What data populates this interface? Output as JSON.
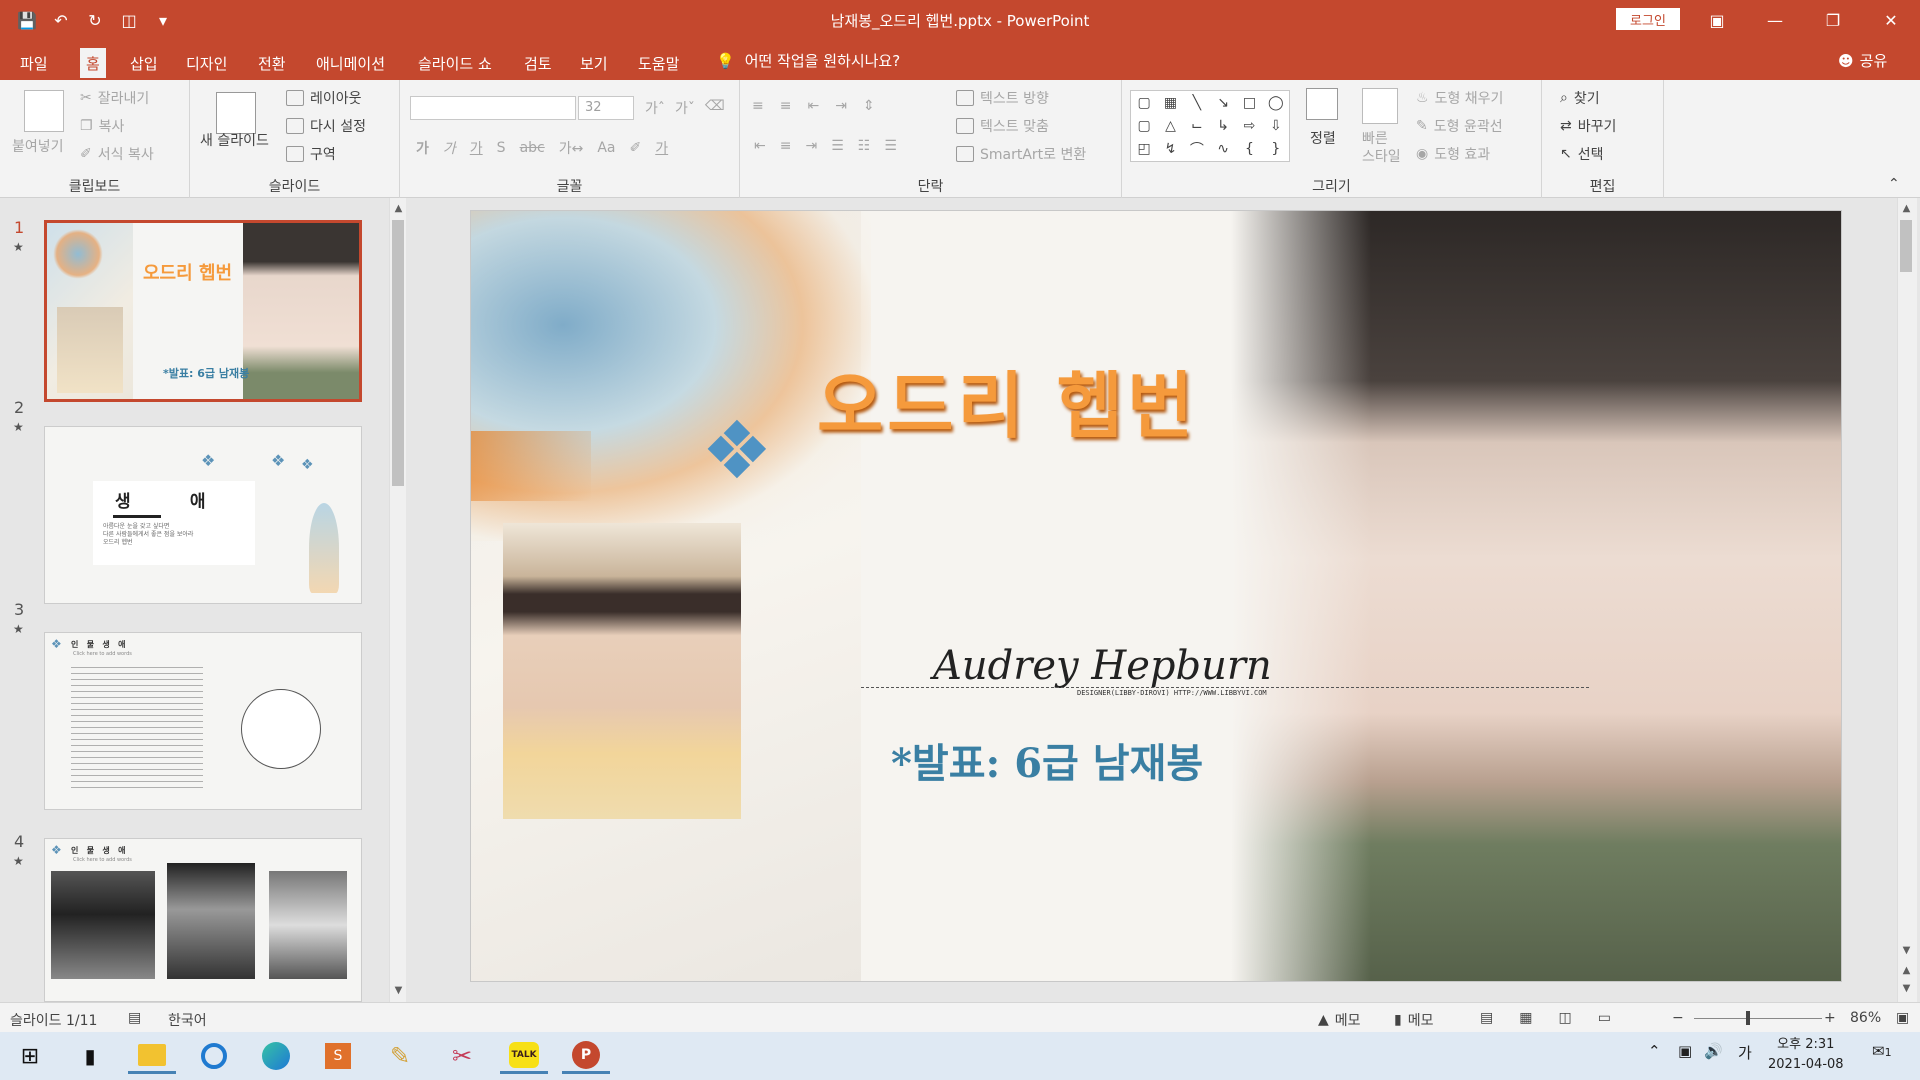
{
  "titlebar": {
    "title": "남재봉_오드리 헵번.pptx  -  PowerPoint",
    "login_label": "로그인"
  },
  "menu": {
    "tabs": [
      "파일",
      "홈",
      "삽입",
      "디자인",
      "전환",
      "애니메이션",
      "슬라이드 쇼",
      "검토",
      "보기",
      "도움말"
    ],
    "tell_me": "어떤 작업을 원하시나요?",
    "share": "공유"
  },
  "ribbon": {
    "clipboard": {
      "paste": "붙여넣기",
      "cut": "잘라내기",
      "copy": "복사",
      "format_painter": "서식 복사",
      "label": "클립보드"
    },
    "slides": {
      "new_slide": "새 슬라이드",
      "layout": "레이아웃",
      "reset": "다시 설정",
      "section": "구역",
      "label": "슬라이드"
    },
    "font": {
      "size": "32",
      "label": "글꼴"
    },
    "paragraph": {
      "text_direction": "텍스트 방향",
      "align_text": "텍스트 맞춤",
      "smartart": "SmartArt로 변환",
      "label": "단락"
    },
    "drawing": {
      "arrange": "정렬",
      "quick_styles": "빠른\n스타일",
      "shape_fill": "도형 채우기",
      "shape_outline": "도형 윤곽선",
      "shape_effects": "도형 효과",
      "label": "그리기"
    },
    "editing": {
      "find": "찾기",
      "replace": "바꾸기",
      "select": "선택",
      "label": "편집"
    }
  },
  "thumbnails": [
    {
      "num": "1",
      "title": "오드리 헵번",
      "sub": "*발표: 6급 남재봉"
    },
    {
      "num": "2",
      "title": "생          애",
      "sub": "아름다운 눈을 갖고 싶다면\n다른 사람들에게서 좋은 점을 보아라\n오드리 헵번"
    },
    {
      "num": "3",
      "title": "인   물   생   애",
      "sub": "Click here to add words"
    },
    {
      "num": "4",
      "title": "인   물   생   애",
      "sub": "Click here to add words"
    }
  ],
  "slide": {
    "title": "오드리 헵번",
    "signature": "Audrey Hepburn",
    "credit": "DESIGNER(LIBBY-DIROVI) HTTP://WWW.LIBBYVI.COM",
    "presenter": "*발표: 6급 남재봉"
  },
  "status": {
    "slide_info": "슬라이드 1/11",
    "language": "한국어",
    "notes": "메모",
    "comments": "메모",
    "zoom": "86%"
  },
  "taskbar": {
    "time": "오후 2:31",
    "date": "2021-04-08",
    "ime": "가",
    "notification_count": "1"
  },
  "colors": {
    "accent": "#c4482e",
    "title_orange": "#f59a3c",
    "presenter_blue": "#3a7fa3"
  }
}
